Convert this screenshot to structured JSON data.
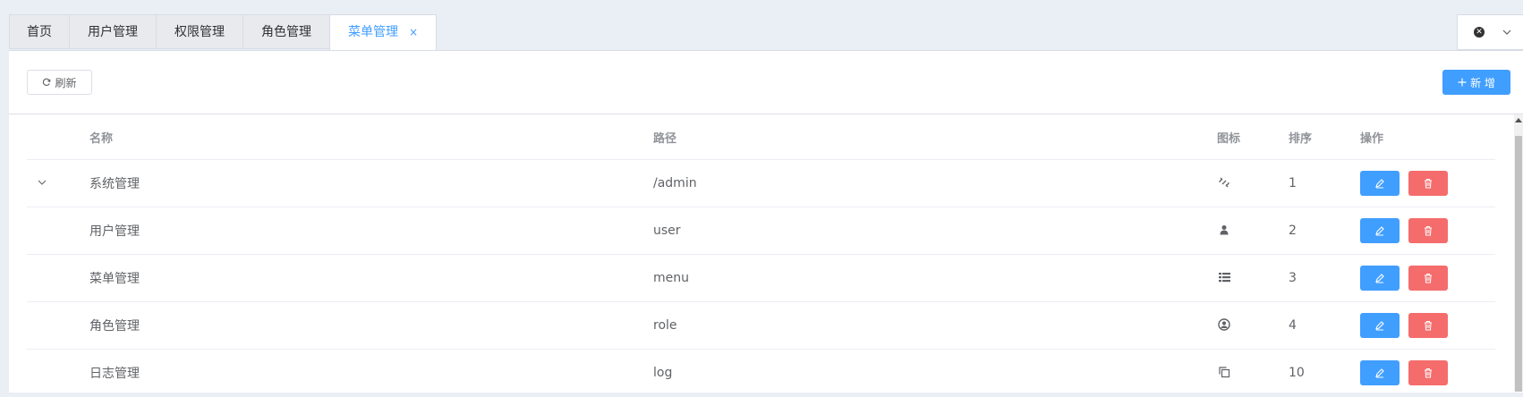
{
  "tabs": [
    {
      "label": "首页",
      "active": false
    },
    {
      "label": "用户管理",
      "active": false
    },
    {
      "label": "权限管理",
      "active": false
    },
    {
      "label": "角色管理",
      "active": false
    },
    {
      "label": "菜单管理",
      "active": true
    }
  ],
  "tab_close_glyph": "×",
  "toolbar": {
    "refresh_label": "刷新",
    "add_label": "新 增"
  },
  "table": {
    "headers": {
      "name": "名称",
      "path": "路径",
      "icon": "图标",
      "sort": "排序",
      "ops": "操作"
    },
    "rows": [
      {
        "name": "系统管理",
        "path": "/admin",
        "icon": "unlink-icon",
        "sort": "1",
        "expandable": true
      },
      {
        "name": "用户管理",
        "path": "user",
        "icon": "user-icon",
        "sort": "2",
        "expandable": false
      },
      {
        "name": "菜单管理",
        "path": "menu",
        "icon": "list-icon",
        "sort": "3",
        "expandable": false
      },
      {
        "name": "角色管理",
        "path": "role",
        "icon": "user-circle-icon",
        "sort": "4",
        "expandable": false
      },
      {
        "name": "日志管理",
        "path": "log",
        "icon": "copy-icon",
        "sort": "10",
        "expandable": false
      }
    ]
  },
  "colors": {
    "primary": "#409eff",
    "danger": "#f56c6c",
    "background": "#eaeef5"
  }
}
